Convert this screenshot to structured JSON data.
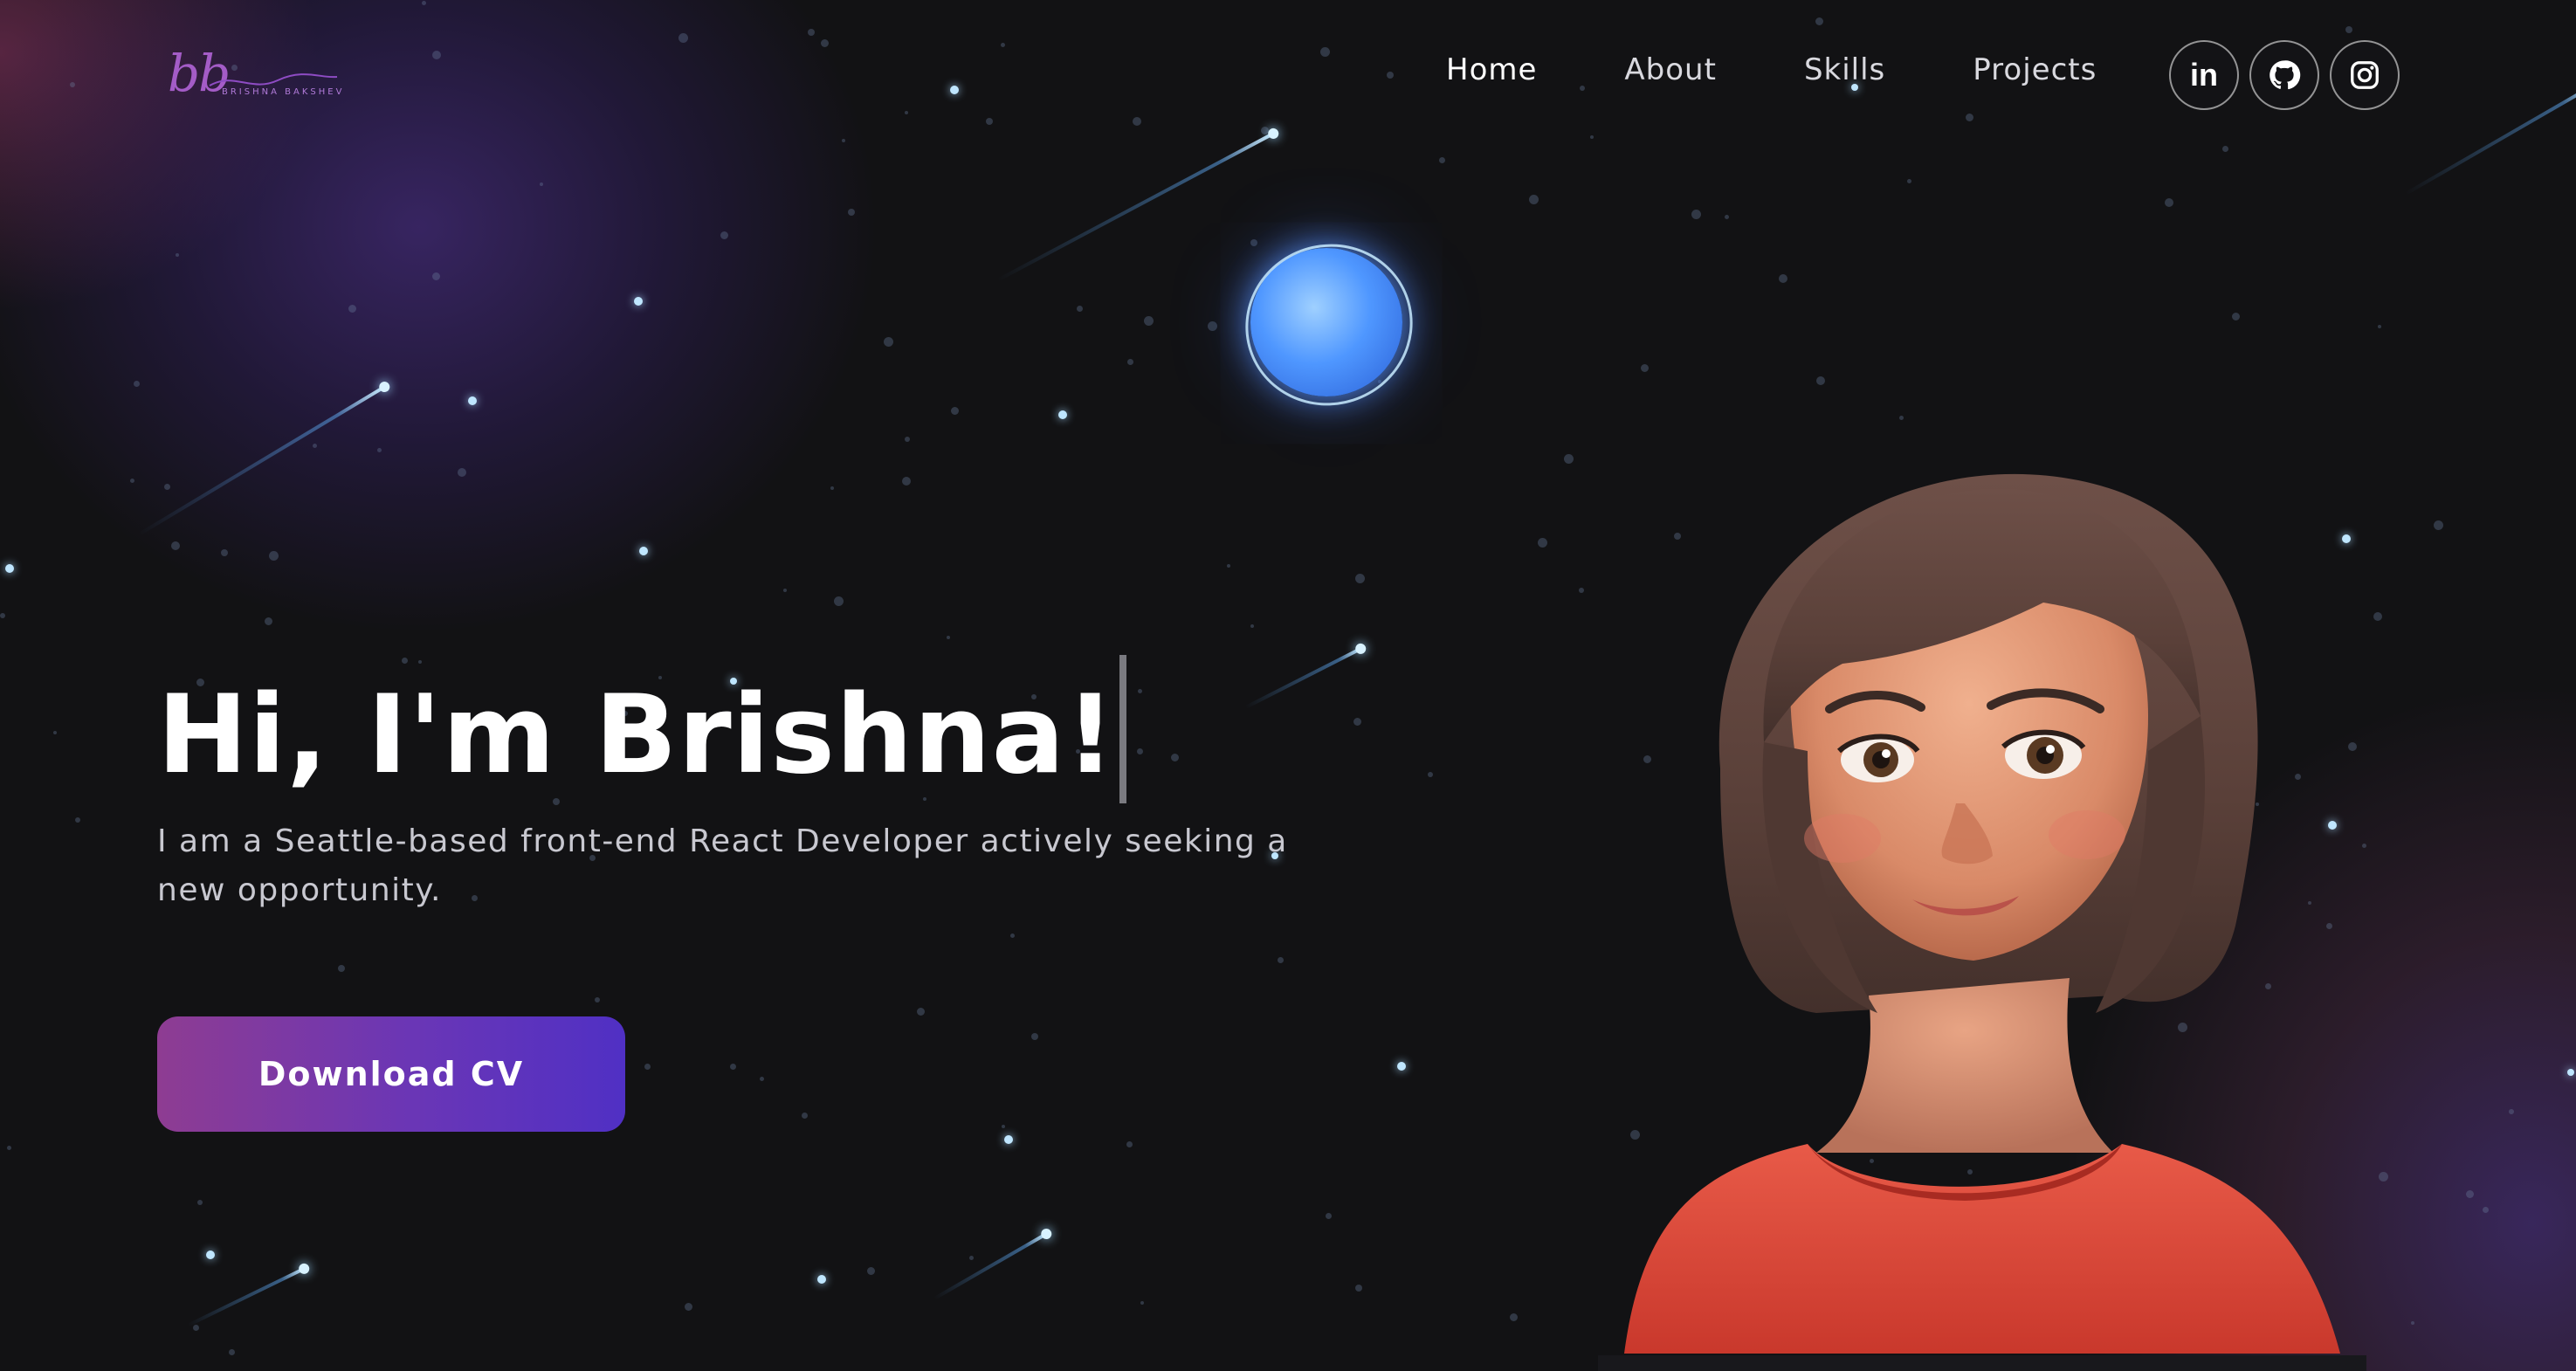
{
  "brand": {
    "logo_mark": "bb",
    "logo_name": "BRISHNA BAKSHEV"
  },
  "nav": {
    "links": [
      {
        "label": "Home",
        "active": true
      },
      {
        "label": "About",
        "active": false
      },
      {
        "label": "Skills",
        "active": false
      },
      {
        "label": "Projects",
        "active": false
      }
    ],
    "socials": [
      {
        "icon": "linkedin-icon",
        "glyph": "in"
      },
      {
        "icon": "github-icon"
      },
      {
        "icon": "instagram-icon"
      }
    ]
  },
  "hero": {
    "title": "Hi, I'm Brishna!",
    "subtitle": "I am a Seattle-based front-end React Developer actively seeking a new opportunity.",
    "cta_label": "Download CV"
  },
  "colors": {
    "background": "#121214",
    "accent_start": "#8e3c92",
    "accent_end": "#5030c4",
    "planet": "#4f97ff",
    "shirt": "#e0483a"
  }
}
